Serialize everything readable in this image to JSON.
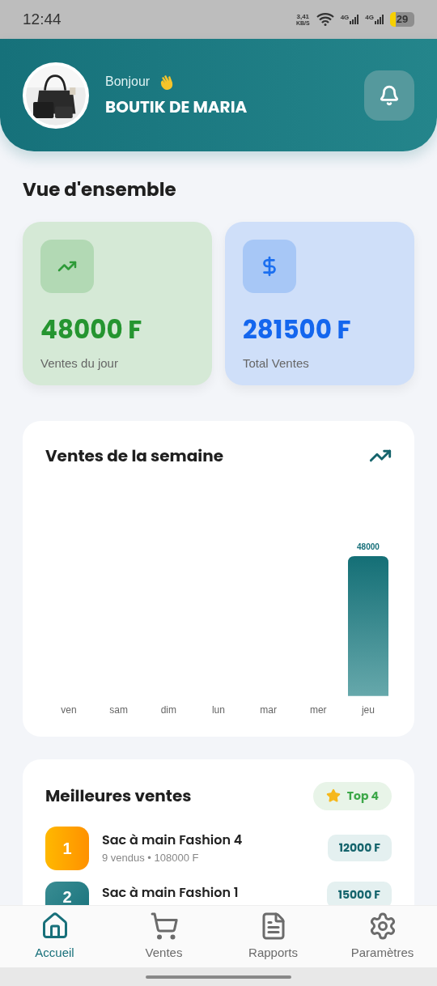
{
  "status_bar": {
    "time": "12:44",
    "speed": "3,41",
    "speed_unit": "KB/S",
    "networks": [
      "4G",
      "4G"
    ],
    "battery": "29"
  },
  "header": {
    "greeting": "Bonjour",
    "shop_name": "BOUTIK DE MARIA"
  },
  "overview": {
    "title": "Vue d'ensemble",
    "cards": [
      {
        "kind": "trend",
        "value": "48000 F",
        "label": "Ventes du jour"
      },
      {
        "kind": "money",
        "value": "281500 F",
        "label": "Total Ventes"
      }
    ]
  },
  "weekly": {
    "title": "Ventes de la semaine",
    "chart_data": {
      "type": "bar",
      "categories": [
        "ven",
        "sam",
        "dim",
        "lun",
        "mar",
        "mer",
        "jeu"
      ],
      "values": [
        0,
        0,
        0,
        0,
        0,
        0,
        48000
      ],
      "value_labels": [
        null,
        null,
        null,
        null,
        null,
        null,
        "48000"
      ]
    }
  },
  "best_sales": {
    "title": "Meilleures ventes",
    "badge": "Top 4",
    "items": [
      {
        "rank": "1",
        "name": "Sac à main Fashion 4",
        "detail": "9 vendus • 108000 F",
        "price": "12000 F"
      },
      {
        "rank": "2",
        "name": "Sac à main Fashion 1",
        "price": "15000 F"
      }
    ]
  },
  "nav": [
    {
      "kind": "home",
      "label": "Accueil",
      "selected": true
    },
    {
      "kind": "cart",
      "label": "Ventes",
      "selected": false
    },
    {
      "kind": "doc",
      "label": "Rapports",
      "selected": false
    },
    {
      "kind": "gear",
      "label": "Paramètres",
      "selected": false
    }
  ]
}
